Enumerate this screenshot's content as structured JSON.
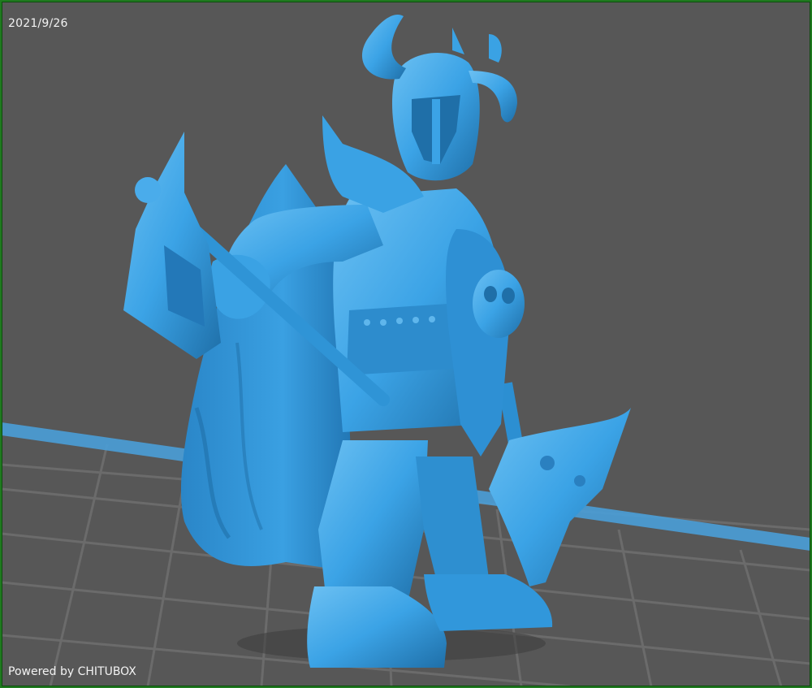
{
  "viewport": {
    "date": "2021/9/26",
    "watermark": "Powered by CHITUBOX"
  },
  "colors": {
    "frame": "#1f7a1f",
    "background": "#575757",
    "grid": "#6a6a6a",
    "axis": "#4a9fd8",
    "model": "#3ba3e6",
    "model_shadow": "#1f6fa8",
    "model_highlight": "#7cc8f5"
  },
  "model": {
    "name": "horned-knight-miniature"
  }
}
